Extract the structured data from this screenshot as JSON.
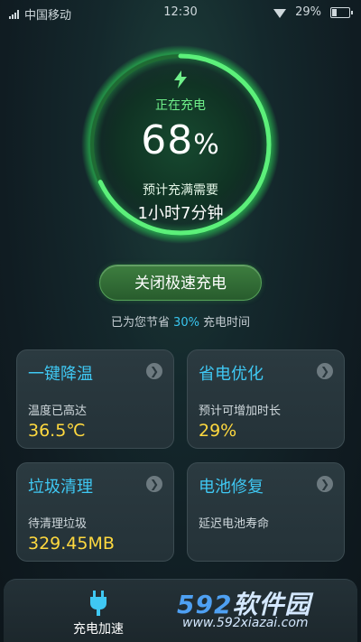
{
  "status_bar": {
    "carrier": "中国移动",
    "time": "12:30",
    "battery_text": "29%",
    "battery_level": 0.29,
    "icons": [
      "signal-icon",
      "wifi-icon",
      "battery-icon"
    ]
  },
  "charging": {
    "icon": "lightning-bolt-icon",
    "status_label": "正在充电",
    "percent_value": "68",
    "percent_unit": "%",
    "eta_label": "预计充满需要",
    "eta_value": "1小时7分钟",
    "ring_progress": 0.68
  },
  "fast_charge": {
    "button_label": "关闭极速充电"
  },
  "saving": {
    "prefix": "已为您节省",
    "percent": "30%",
    "suffix": "充电时间"
  },
  "cards": [
    {
      "title": "一键降温",
      "desc": "温度已高达",
      "value": "36.5℃"
    },
    {
      "title": "省电优化",
      "desc": "预计可增加时长",
      "value": "29%"
    },
    {
      "title": "垃圾清理",
      "desc": "待清理垃圾",
      "value": "329.45MB"
    },
    {
      "title": "电池修复",
      "desc": "延迟电池寿命",
      "value": ""
    }
  ],
  "bottom_nav": {
    "charge_label": "充电加速",
    "charge_icon": "plug-icon"
  },
  "watermark": {
    "brand_num": "592",
    "brand_text": "软件园",
    "url": "www.592xiazai.com"
  },
  "colors": {
    "accent_green": "#6ff08a",
    "accent_blue": "#3fc8f3",
    "value_yellow": "#ffd93f",
    "button_green": "#2f6b33"
  }
}
